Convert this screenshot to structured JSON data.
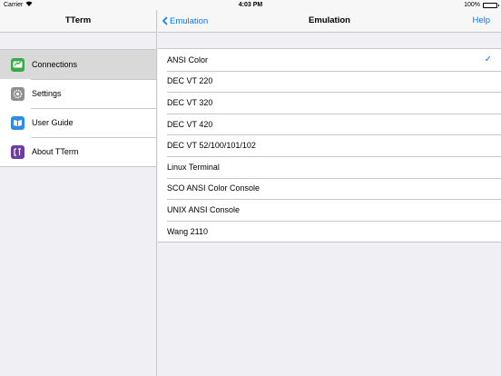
{
  "status_bar": {
    "carrier": "Carrier",
    "time": "4:03 PM",
    "battery": "100%"
  },
  "sidebar": {
    "title": "TTerm",
    "items": [
      {
        "label": "Connections",
        "icon": "connections-icon",
        "selected": true
      },
      {
        "label": "Settings",
        "icon": "gear-icon",
        "selected": false
      },
      {
        "label": "User Guide",
        "icon": "book-icon",
        "selected": false
      },
      {
        "label": "About TTerm",
        "icon": "about-icon",
        "selected": false
      }
    ]
  },
  "main": {
    "back_label": "Emulation",
    "title": "Emulation",
    "help_label": "Help",
    "checkmark": "✓",
    "options": [
      {
        "label": "ANSI Color",
        "checked": true
      },
      {
        "label": "DEC VT 220",
        "checked": false
      },
      {
        "label": "DEC VT 320",
        "checked": false
      },
      {
        "label": "DEC VT 420",
        "checked": false
      },
      {
        "label": "DEC VT 52/100/101/102",
        "checked": false
      },
      {
        "label": "Linux Terminal",
        "checked": false
      },
      {
        "label": "SCO ANSI Color Console",
        "checked": false
      },
      {
        "label": "UNIX ANSI Console",
        "checked": false
      },
      {
        "label": "Wang 2110",
        "checked": false
      }
    ]
  },
  "colors": {
    "accent": "#007aff",
    "selected_row": "#d9d9d9",
    "background": "#efeff4"
  }
}
